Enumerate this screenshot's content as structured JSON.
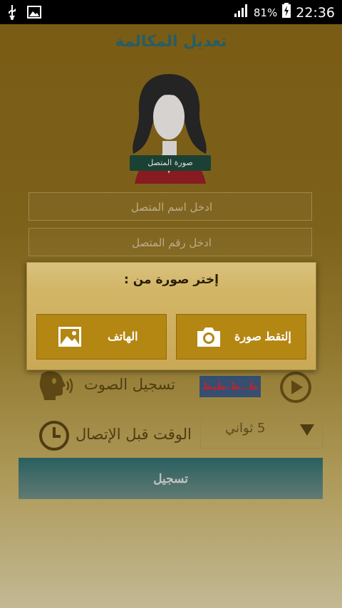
{
  "status_bar": {
    "battery_percent": "81%",
    "time": "22:36",
    "icons": [
      "usb-icon",
      "image-notification-icon",
      "signal-icon",
      "battery-charging-icon"
    ]
  },
  "page": {
    "title": "تعديل المكالمة",
    "avatar_label": "صورة المتصل"
  },
  "form": {
    "name_placeholder": "ادخل اسم المتصل",
    "number_placeholder": "ادخل رقم المتصل",
    "audio_label": "تسجيل الصوت",
    "audio_wave_text": "ظ..ظ.ظيظ",
    "delay_label": "الوقت قبل الإتصال",
    "delay_value": "5 ثواني",
    "save_label": "تسجيل"
  },
  "dialog": {
    "title": "إختر صورة من :",
    "camera_label": "إلتقط صورة",
    "gallery_label": "الهاتف"
  },
  "colors": {
    "background_top": "#8a6818",
    "title_color": "#2d6a75",
    "dialog_button": "#b48612",
    "save_button": "#2f6d6e"
  }
}
